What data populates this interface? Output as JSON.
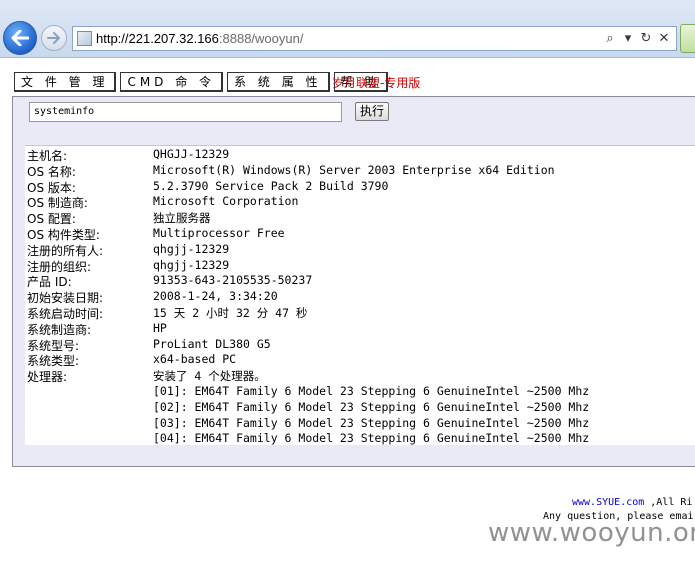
{
  "browser": {
    "url_host": "http://221.207.32.166",
    "url_rest": ":8888/wooyun/"
  },
  "menu": [
    "文 件 管 理",
    "CMD 命 令",
    "系 统 属 性",
    "帮 助"
  ],
  "brand": "岁月联盟-专用版",
  "command": {
    "value": "systeminfo",
    "button": "执行"
  },
  "sysinfo": [
    {
      "k": "主机名:",
      "v": "QHGJJ-12329"
    },
    {
      "k": "OS 名称:",
      "v": "Microsoft(R) Windows(R) Server 2003 Enterprise x64 Edition"
    },
    {
      "k": "OS 版本:",
      "v": "5.2.3790 Service Pack 2 Build 3790"
    },
    {
      "k": "OS 制造商:",
      "v": "Microsoft Corporation"
    },
    {
      "k": "OS 配置:",
      "v": "独立服务器"
    },
    {
      "k": "OS 构件类型:",
      "v": "Multiprocessor Free"
    },
    {
      "k": "注册的所有人:",
      "v": "qhgjj-12329"
    },
    {
      "k": "注册的组织:",
      "v": "qhgjj-12329"
    },
    {
      "k": "产品 ID:",
      "v": "91353-643-2105535-50237"
    },
    {
      "k": "初始安装日期:",
      "v": "2008-1-24, 3:34:20"
    },
    {
      "k": "系统启动时间:",
      "v": "15 天 2 小时 32 分 47 秒"
    },
    {
      "k": "系统制造商:",
      "v": "HP"
    },
    {
      "k": "系统型号:",
      "v": "ProLiant DL380 G5"
    },
    {
      "k": "系统类型:",
      "v": "x64-based PC"
    },
    {
      "k": "处理器:",
      "v": "安装了 4 个处理器。"
    },
    {
      "k": "",
      "v": "[01]: EM64T Family 6 Model 23 Stepping 6 GenuineIntel ~2500 Mhz"
    },
    {
      "k": "",
      "v": "[02]: EM64T Family 6 Model 23 Stepping 6 GenuineIntel ~2500 Mhz"
    },
    {
      "k": "",
      "v": "[03]: EM64T Family 6 Model 23 Stepping 6 GenuineIntel ~2500 Mhz"
    },
    {
      "k": "",
      "v": "[04]: EM64T Family 6 Model 23 Stepping 6 GenuineIntel ~2500 Mhz"
    }
  ],
  "footer": {
    "link": "www.SYUE.com",
    "line1_rest": " ,All Ri",
    "line2": "Any question, please emai"
  },
  "watermark": "www.wooyun.org"
}
